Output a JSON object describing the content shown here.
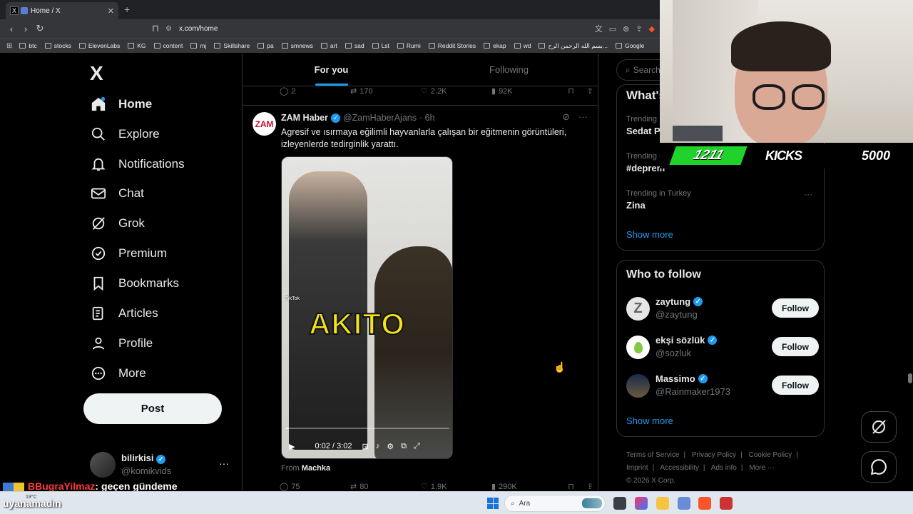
{
  "browser": {
    "tab_title": "Home / X",
    "tab_favicon": "X",
    "url": "x.com/home",
    "bookmarks": [
      "btc",
      "stocks",
      "ElevenLabs",
      "KG",
      "content",
      "mj",
      "Skillshare",
      "pa",
      "smnews",
      "art",
      "sad",
      "Lst",
      "Rumi",
      "Reddit Stories",
      "ekap",
      "wd",
      "بسم الله الرحمن الرح...",
      "Google"
    ]
  },
  "stream": {
    "kicks_count": "1211",
    "kicks_word": "KICKS",
    "kicks_goal": "5000",
    "chat_user": "BBugraYilmaz",
    "chat_text": ": geçen gündeme",
    "chat_text2": "uyanamadın"
  },
  "nav": {
    "logo": "X",
    "items": [
      {
        "label": "Home",
        "icon": "home-icon"
      },
      {
        "label": "Explore",
        "icon": "search-icon"
      },
      {
        "label": "Notifications",
        "icon": "bell-icon"
      },
      {
        "label": "Chat",
        "icon": "mail-icon"
      },
      {
        "label": "Grok",
        "icon": "grok-icon"
      },
      {
        "label": "Premium",
        "icon": "verified-icon"
      },
      {
        "label": "Bookmarks",
        "icon": "bookmark-icon"
      },
      {
        "label": "Articles",
        "icon": "articles-icon"
      },
      {
        "label": "Profile",
        "icon": "person-icon"
      },
      {
        "label": "More",
        "icon": "more-icon"
      }
    ],
    "post_label": "Post",
    "account": {
      "name": "bilirkisi",
      "handle": "@komikvids"
    }
  },
  "feed": {
    "tabs": [
      "For you",
      "Following"
    ],
    "prev_actions": {
      "replies": "2",
      "reposts": "170",
      "likes": "2.2K",
      "views": "92K"
    },
    "tweet": {
      "avatar_text": "ZAM",
      "name": "ZAM Haber",
      "handle": "@ZamHaberAjans",
      "time": "· 6h",
      "text": "Agresif ve ısırmaya eğilimli hayvanlarla çalışan bir eğitmenin görüntüleri, izleyenlerde tedirginlik yarattı.",
      "video": {
        "caption": "AKITO",
        "watermark": "TikTok",
        "time": "0:02 / 3:02",
        "progress": 0.01
      },
      "from_label": "From",
      "from_source": "Machka",
      "actions": {
        "replies": "75",
        "reposts": "80",
        "likes": "1.9K",
        "views": "290K"
      }
    }
  },
  "sidebar": {
    "search_placeholder": "Search",
    "trends_title": "What's happening",
    "trends": [
      {
        "context": "Trending",
        "topic": "Sedat P"
      },
      {
        "context": "Trending in Turkey",
        "topic": "#deprem"
      },
      {
        "context": "Trending in Turkey",
        "topic": "Zina"
      }
    ],
    "show_more": "Show more",
    "who_to_follow_title": "Who to follow",
    "follow_suggestions": [
      {
        "name": "zaytung",
        "handle": "@zaytung",
        "follow": "Follow",
        "avatar_color": "#e6e6e6"
      },
      {
        "name": "ekşi sözlük",
        "handle": "@sozluk",
        "follow": "Follow",
        "avatar_color": "#ffffff"
      },
      {
        "name": "Massimo",
        "handle": "@Rainmaker1973",
        "follow": "Follow",
        "avatar_color": "#3a4a6a"
      }
    ],
    "footer": [
      "Terms of Service",
      "|",
      "Privacy Policy",
      "|",
      "Cookie Policy",
      "|",
      "Imprint",
      "|",
      "Accessibility",
      "|",
      "Ads info",
      "|",
      "More ···",
      "© 2026 X Corp."
    ]
  },
  "taskbar": {
    "weather": "19°C",
    "search_label": "Ara"
  },
  "colors": {
    "accent": "#1d9bf0",
    "kick_green": "#1fd32b",
    "background": "#000000"
  }
}
